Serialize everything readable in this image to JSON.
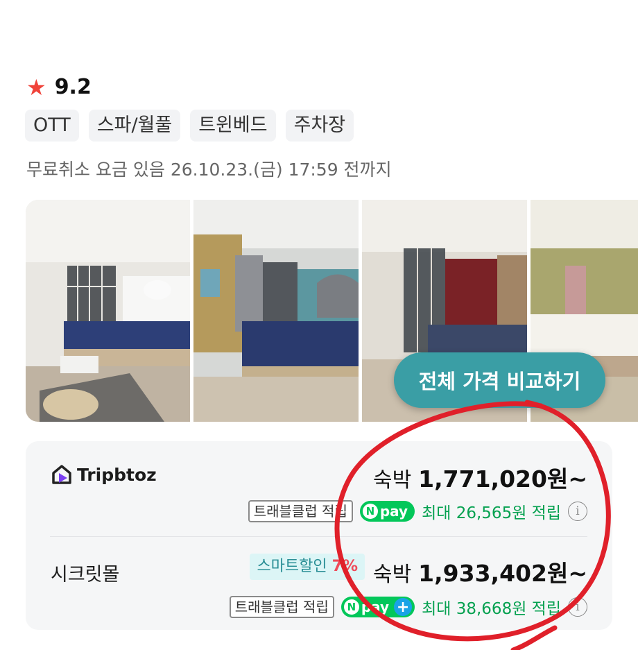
{
  "rating": {
    "star_icon": "star-icon",
    "score": "9.2"
  },
  "tags": [
    "OTT",
    "스파/월풀",
    "트윈베드",
    "주차장"
  ],
  "cancellation": "무료취소 요금 있음 26.10.23.(금) 17:59 전까지",
  "compare_button": "전체 가격 비교하기",
  "offers": [
    {
      "provider": "Tripbtoz",
      "price_label": "숙박",
      "price": "1,771,020원~",
      "club_badge": "트래블클럽 적립",
      "npay_text": "pay",
      "points": "최대 26,565원 적립"
    },
    {
      "provider": "시크릿몰",
      "discount_label": "스마트할인",
      "discount_pct": "7%",
      "price_label": "숙박",
      "price": "1,933,402원~",
      "club_badge": "트래블클럽 적립",
      "npay_text": "pay",
      "npay_plus": "+",
      "points": "최대 38,668원 적립"
    }
  ],
  "colors": {
    "star": "#f0433a",
    "accent_button": "#3a9ea5",
    "npay_green": "#03c75a",
    "points_green": "#05a150",
    "discount_red": "#ef4b5a",
    "annotation_red": "#e0202a"
  }
}
